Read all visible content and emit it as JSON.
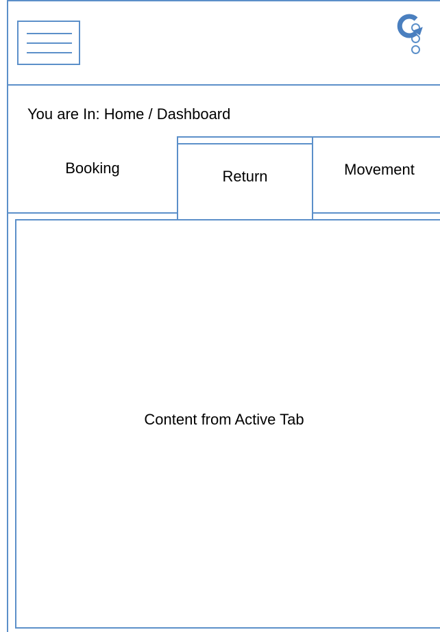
{
  "header": {
    "menu_icon": "hamburger-menu-icon",
    "more_icon": "kebab-more-icon"
  },
  "breadcrumb": {
    "text": "You are In: Home / Dashboard",
    "refresh_icon": "refresh-icon"
  },
  "tabs": [
    {
      "label": "Booking",
      "active": false
    },
    {
      "label": "Return",
      "active": true
    },
    {
      "label": "Movement",
      "active": false
    }
  ],
  "content": {
    "placeholder": "Content from Active Tab"
  },
  "colors": {
    "wireframe_stroke": "#5b8fc9",
    "background": "#ffffff"
  }
}
